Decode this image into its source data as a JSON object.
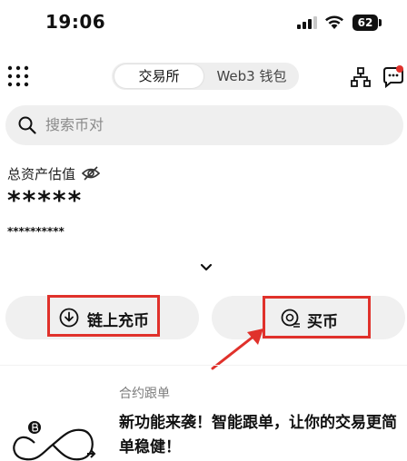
{
  "status_bar": {
    "time": "19:06",
    "battery": "62"
  },
  "header": {
    "tabs": [
      {
        "label": "交易所",
        "active": true
      },
      {
        "label": "Web3 钱包",
        "active": false
      }
    ]
  },
  "search": {
    "placeholder": "搜索币对"
  },
  "assets": {
    "label": "总资产估值",
    "value": "*****",
    "sub_value": "**********"
  },
  "actions": {
    "deposit_label": "链上充币",
    "buy_label": "买币"
  },
  "promo": {
    "kicker": "合约跟单",
    "headline_line1": "新功能来袭！智能跟单，让你的交易更简",
    "headline_line2": "单稳健！"
  },
  "colors": {
    "highlight": "#e0312b",
    "notification": "#e0312b",
    "pill_bg": "#f0f0f0"
  }
}
